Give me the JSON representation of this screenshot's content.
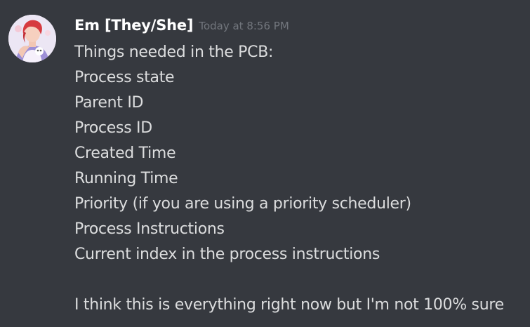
{
  "message": {
    "username": "Em [They/She]",
    "timestamp": "Today at 8:56 PM",
    "lines": [
      "Things needed in the PCB:",
      "Process state",
      "Parent ID",
      "Process ID",
      "Created Time",
      "Running Time",
      "Priority (if you are using a priority scheduler)",
      "Process Instructions",
      "Current index in the process instructions",
      "",
      "I think this is everything right now but I'm not 100% sure"
    ]
  },
  "colors": {
    "background": "#36393f",
    "username": "#ffffff",
    "timestamp": "#72767d",
    "text": "#dcddde"
  },
  "icons": {
    "avatar": "user-avatar-illustration"
  }
}
